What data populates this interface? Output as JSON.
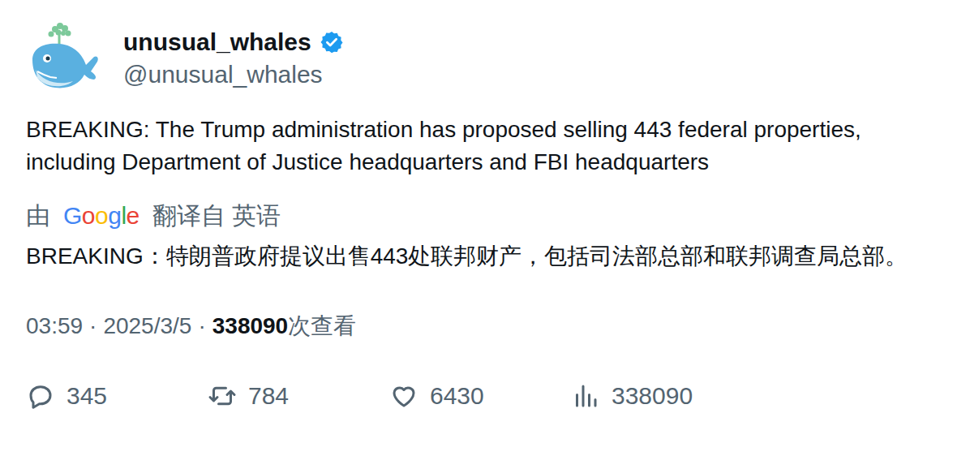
{
  "author": {
    "name": "unusual_whales",
    "handle": "@unusual_whales",
    "verified": true
  },
  "tweet": {
    "text": "BREAKING: The Trump administration has proposed selling 443 federal properties, including Department of Justice headquarters and FBI headquarters"
  },
  "translation": {
    "prefix": "由",
    "provider": [
      {
        "char": "G",
        "color": "#4285F4"
      },
      {
        "char": "o",
        "color": "#EA4335"
      },
      {
        "char": "o",
        "color": "#FBBC05"
      },
      {
        "char": "g",
        "color": "#4285F4"
      },
      {
        "char": "l",
        "color": "#34A853"
      },
      {
        "char": "e",
        "color": "#EA4335"
      }
    ],
    "suffix": "翻译自 英语",
    "text": "BREAKING：特朗普政府提议出售443处联邦财产，包括司法部总部和联邦调查局总部。"
  },
  "meta": {
    "time": "03:59",
    "separator": "·",
    "date": "2025/3/5",
    "views": "338090",
    "views_label": "次查看"
  },
  "actions": [
    {
      "kind": "reply",
      "count": "345"
    },
    {
      "kind": "retweet",
      "count": "784"
    },
    {
      "kind": "like",
      "count": "6430"
    },
    {
      "kind": "views",
      "count": "338090"
    }
  ]
}
